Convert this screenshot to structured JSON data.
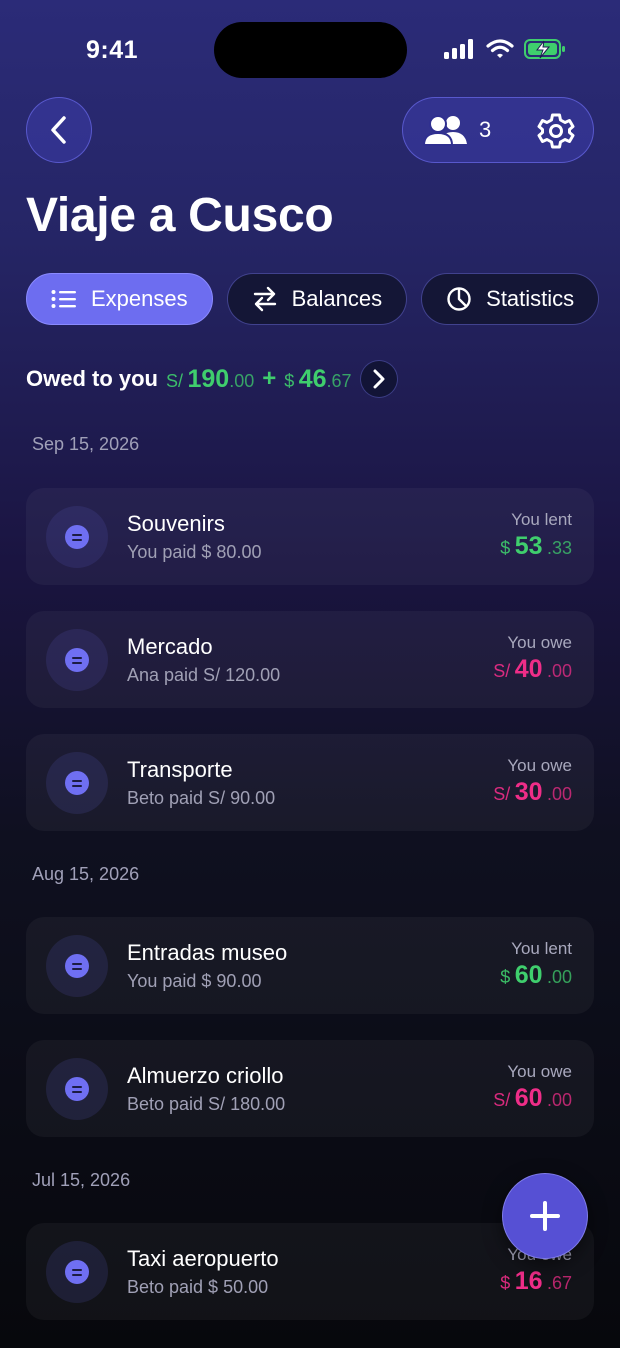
{
  "status_bar": {
    "time": "9:41"
  },
  "header": {
    "member_count": "3",
    "title": "Viaje a Cusco"
  },
  "tabs": [
    {
      "label": "Expenses",
      "active": true,
      "icon": "list-icon"
    },
    {
      "label": "Balances",
      "active": false,
      "icon": "swap-icon"
    },
    {
      "label": "Statistics",
      "active": false,
      "icon": "pie-chart-icon"
    }
  ],
  "owed": {
    "label": "Owed to you",
    "a_currency": "S/",
    "a_int": "190",
    "a_dec": ".00",
    "plus": "+",
    "b_currency": "$",
    "b_int": "46",
    "b_dec": ".67"
  },
  "groups": [
    {
      "date": "Sep 15, 2026"
    },
    {
      "date": "Aug 15, 2026"
    },
    {
      "date": "Jul 15, 2026"
    }
  ],
  "expenses": [
    {
      "title": "Souvenirs",
      "subtitle": "You paid $ 80.00",
      "status": "You lent",
      "currency": "$",
      "int": "53",
      "dec": ".33",
      "tone": "green"
    },
    {
      "title": "Mercado",
      "subtitle": "Ana paid S/ 120.00",
      "status": "You owe",
      "currency": "S/",
      "int": "40",
      "dec": ".00",
      "tone": "pink"
    },
    {
      "title": "Transporte",
      "subtitle": "Beto paid S/ 90.00",
      "status": "You owe",
      "currency": "S/",
      "int": "30",
      "dec": ".00",
      "tone": "pink"
    },
    {
      "title": "Entradas museo",
      "subtitle": "You paid $ 90.00",
      "status": "You lent",
      "currency": "$",
      "int": "60",
      "dec": ".00",
      "tone": "green"
    },
    {
      "title": "Almuerzo criollo",
      "subtitle": "Beto paid S/ 180.00",
      "status": "You owe",
      "currency": "S/",
      "int": "60",
      "dec": ".00",
      "tone": "pink"
    },
    {
      "title": "Taxi aeropuerto",
      "subtitle": "Beto paid $ 50.00",
      "status": "You owe",
      "currency": "$",
      "int": "16",
      "dec": ".67",
      "tone": "pink"
    }
  ],
  "colors": {
    "accent": "#6d6df0",
    "positive": "#3fce6d",
    "negative": "#ef2d88"
  }
}
